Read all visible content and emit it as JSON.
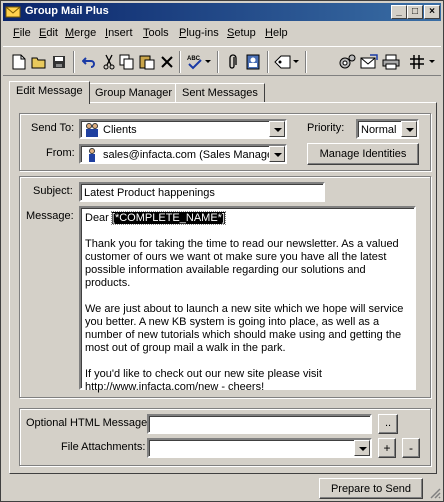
{
  "window": {
    "title": "Group Mail Plus"
  },
  "menu": [
    {
      "label": "File",
      "key": "F",
      "rest": "ile"
    },
    {
      "label": "Edit",
      "key": "E",
      "rest": "dit"
    },
    {
      "label": "Merge",
      "key": "M",
      "rest": "erge"
    },
    {
      "label": "Insert",
      "key": "I",
      "rest": "nsert"
    },
    {
      "label": "Tools",
      "key": "T",
      "rest": "ools"
    },
    {
      "label": "Plug-ins",
      "key": "P",
      "rest": "lug-ins"
    },
    {
      "label": "Setup",
      "key": "S",
      "rest": "etup"
    },
    {
      "label": "Help",
      "key": "H",
      "rest": "elp"
    }
  ],
  "tabs": [
    {
      "label": "Edit Message",
      "active": true
    },
    {
      "label": "Group Manager",
      "active": false
    },
    {
      "label": "Sent Messages",
      "active": false
    }
  ],
  "send_to": {
    "label": "Send To:",
    "value": "Clients"
  },
  "from": {
    "label": "From:",
    "value": "sales@infacta.com  (Sales Manage"
  },
  "priority": {
    "label": "Priority:",
    "value": "Normal"
  },
  "manage_identities_label": "Manage Identities",
  "subject": {
    "label": "Subject:",
    "value": "Latest Product happenings"
  },
  "message": {
    "label": "Message:",
    "greeting": "Dear ",
    "merge_field": "[*COMPLETE_NAME*]",
    "paragraphs": [
      "Thank you for taking the time to read our newsletter. As a valued customer of ours we want ot make sure you have all the latest possible information available regarding our solutions and products.",
      "We are just about to launch a new site which we hope will service you better. A new KB system is going into place, as well as a number of new tutorials which should make using and getting the most out of group mail a walk in the park.",
      "If you'd like to check out our new site please visit\nhttp://www.infacta.com/new - cheers!"
    ]
  },
  "optional_html": {
    "label": "Optional HTML Message:",
    "browse_label": ".."
  },
  "attachments": {
    "label": "File Attachments:",
    "add_label": "+",
    "remove_label": "-"
  },
  "prepare_send_label": "Prepare to Send"
}
